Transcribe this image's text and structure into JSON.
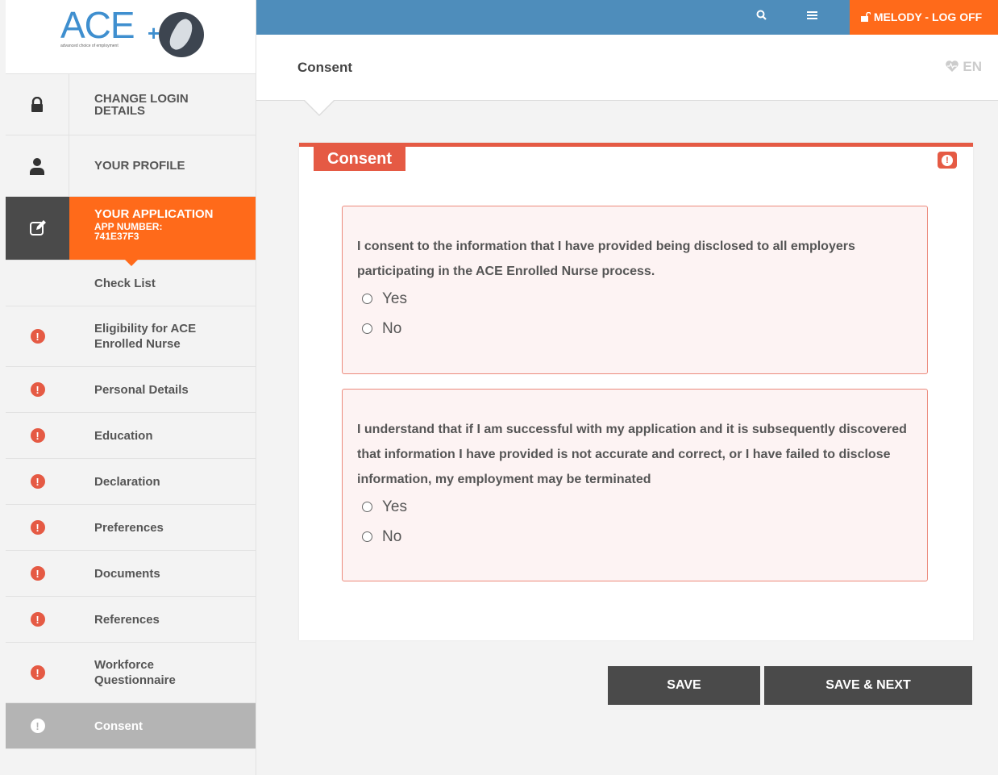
{
  "logo": {
    "text": "ACE",
    "tagline": "advanced choice of employment"
  },
  "topbar": {
    "logoff_label": "MELODY - LOG OFF"
  },
  "header": {
    "title": "Consent",
    "lang": "EN"
  },
  "sidebar": {
    "change_login": "CHANGE LOGIN DETAILS",
    "profile": "YOUR PROFILE",
    "application": {
      "title": "YOUR APPLICATION",
      "app_number_label": "APP NUMBER:",
      "app_number": "741E37F3"
    },
    "items": [
      {
        "label": "Check List"
      },
      {
        "label": "Eligibility for ACE Enrolled Nurse"
      },
      {
        "label": "Personal Details"
      },
      {
        "label": "Education"
      },
      {
        "label": "Declaration"
      },
      {
        "label": "Preferences"
      },
      {
        "label": "Documents"
      },
      {
        "label": "References"
      },
      {
        "label": "Workforce Questionnaire"
      },
      {
        "label": "Consent"
      }
    ]
  },
  "panel": {
    "title": "Consent",
    "questions": [
      {
        "text": "I consent to the information that I have provided being disclosed to all employers participating in the ACE Enrolled Nurse process.",
        "options": [
          "Yes",
          "No"
        ]
      },
      {
        "text": "I understand that if I am successful with my application and it is subsequently discovered that information I have provided is not accurate and correct, or I have failed to disclose information, my employment may be terminated",
        "options": [
          "Yes",
          "No"
        ]
      }
    ]
  },
  "buttons": {
    "save": "SAVE",
    "save_next": "SAVE & NEXT"
  },
  "colors": {
    "accent_orange": "#ff6a1a",
    "topbar_blue": "#4e8dbb",
    "error_red": "#e55a44",
    "dark": "#4a4a4a"
  }
}
